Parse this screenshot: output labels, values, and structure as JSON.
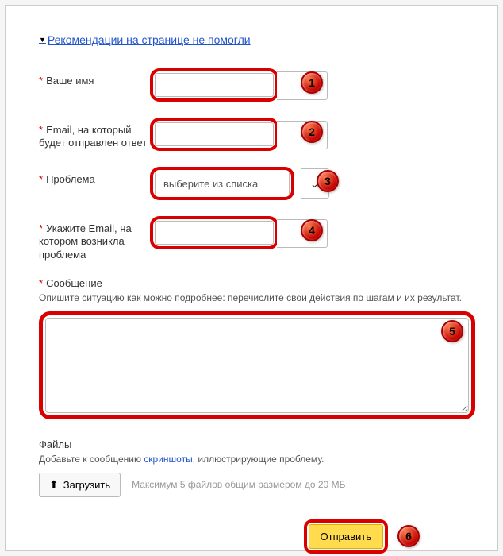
{
  "header": {
    "link_text": "Рекомендации на странице не помогли"
  },
  "fields": {
    "name": {
      "label": "Ваше имя",
      "value": "",
      "badge": "1"
    },
    "email": {
      "label": "Email, на который будет отправлен ответ",
      "value": "",
      "badge": "2"
    },
    "problem": {
      "label": "Проблема",
      "placeholder": "выберите из списка",
      "badge": "3"
    },
    "problem_email": {
      "label": "Укажите Email, на котором возникла проблема",
      "value": "",
      "badge": "4"
    }
  },
  "message": {
    "label": "Сообщение",
    "hint": "Опишите ситуацию как можно подробнее: перечислите свои действия по шагам и их результат.",
    "value": "",
    "badge": "5"
  },
  "files": {
    "label": "Файлы",
    "hint_prefix": "Добавьте к сообщению ",
    "hint_link": "скриншоты",
    "hint_suffix": ", иллюстрирующие проблему.",
    "upload_label": "Загрузить",
    "limit_hint": "Максимум 5 файлов общим размером до 20 МБ"
  },
  "submit": {
    "label": "Отправить",
    "badge": "6"
  }
}
